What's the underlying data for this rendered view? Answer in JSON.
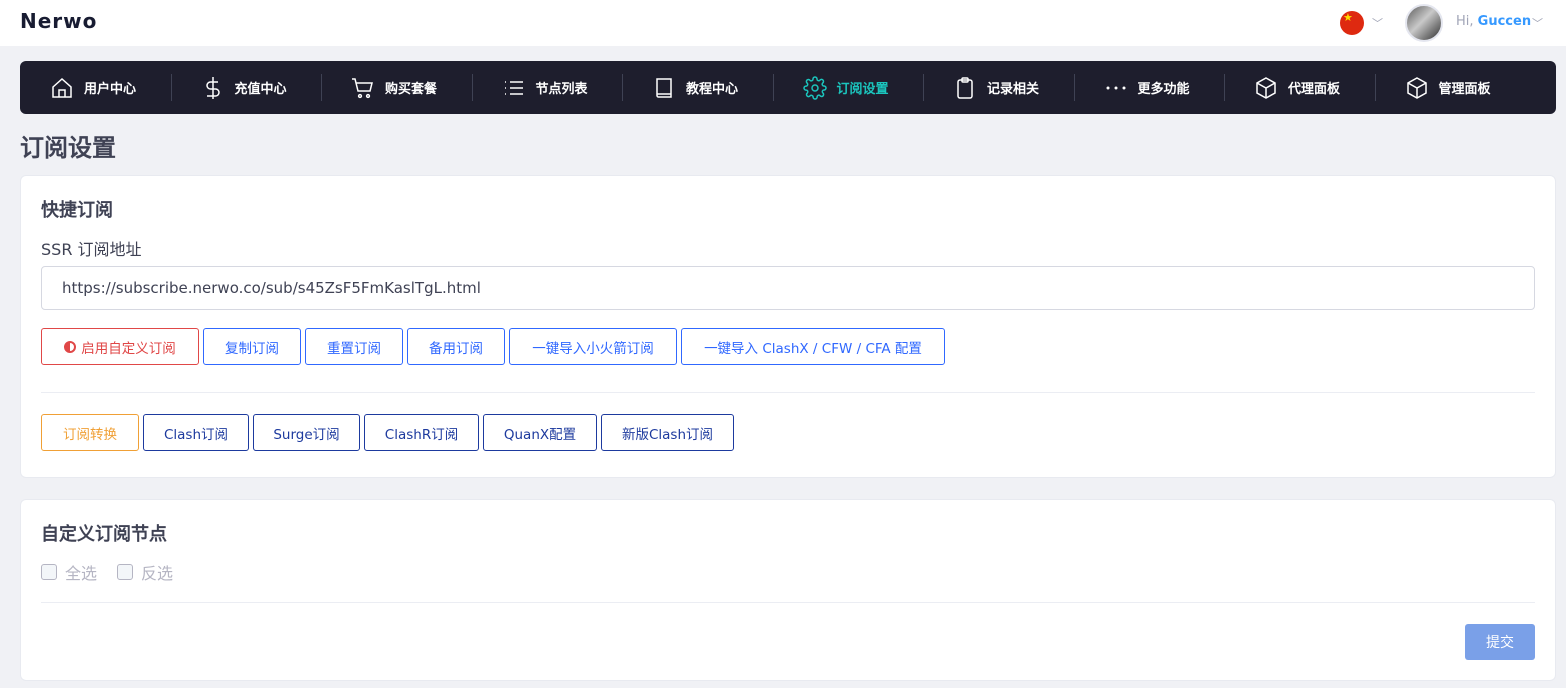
{
  "brand": "Nerwo",
  "language": {
    "flag": "china-flag-icon"
  },
  "user": {
    "greeting_prefix": "Hi,",
    "name": "Guccen"
  },
  "nav": [
    {
      "label": "用户中心",
      "icon": "home-icon"
    },
    {
      "label": "充值中心",
      "icon": "dollar-icon"
    },
    {
      "label": "购买套餐",
      "icon": "cart-icon"
    },
    {
      "label": "节点列表",
      "icon": "list-icon"
    },
    {
      "label": "教程中心",
      "icon": "book-icon"
    },
    {
      "label": "订阅设置",
      "icon": "gear-icon",
      "active": true
    },
    {
      "label": "记录相关",
      "icon": "clipboard-icon"
    },
    {
      "label": "更多功能",
      "icon": "more-icon"
    },
    {
      "label": "代理面板",
      "icon": "cube-icon"
    },
    {
      "label": "管理面板",
      "icon": "cube-icon"
    }
  ],
  "page_title": "订阅设置",
  "quick_sub": {
    "title": "快捷订阅",
    "field_label": "SSR 订阅地址",
    "url": "https://subscribe.nerwo.co/sub/s45ZsF5FmKaslTgL.html",
    "buttons": [
      "启用自定义订阅",
      "复制订阅",
      "重置订阅",
      "备用订阅",
      "一键导入小火箭订阅",
      "一键导入 ClashX / CFW / CFA 配置"
    ],
    "convert_buttons": [
      "订阅转换",
      "Clash订阅",
      "Surge订阅",
      "ClashR订阅",
      "QuanX配置",
      "新版Clash订阅"
    ]
  },
  "custom_nodes": {
    "title": "自定义订阅节点",
    "select_all": "全选",
    "invert": "反选",
    "submit": "提交"
  },
  "colors": {
    "nav_bg": "#1e1e2d",
    "active": "#1bc5bd",
    "primary": "#3068ff",
    "danger": "#e04747",
    "warning": "#f0a036"
  }
}
